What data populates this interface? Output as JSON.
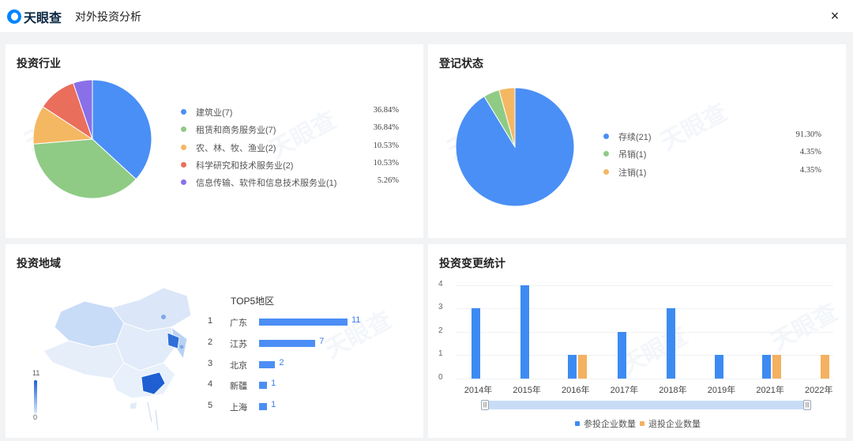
{
  "header": {
    "logo_text": "天眼查",
    "title": "对外投资分析",
    "close_label": "×"
  },
  "watermark": "天眼查",
  "industry": {
    "title": "投资行业",
    "chart_data": {
      "type": "pie",
      "slices": [
        {
          "label": "建筑业(7)",
          "value": 36.84,
          "pct": "36.84%",
          "color": "#4a8ff5"
        },
        {
          "label": "租赁和商务服务业(7)",
          "value": 36.84,
          "pct": "36.84%",
          "color": "#8fcb85"
        },
        {
          "label": "农、林、牧、渔业(2)",
          "value": 10.53,
          "pct": "10.53%",
          "color": "#f4b862"
        },
        {
          "label": "科学研究和技术服务业(2)",
          "value": 10.53,
          "pct": "10.53%",
          "color": "#ea6e5c"
        },
        {
          "label": "信息传输、软件和信息技术服务业(1)",
          "value": 5.26,
          "pct": "5.26%",
          "color": "#8970e8"
        }
      ]
    }
  },
  "status": {
    "title": "登记状态",
    "chart_data": {
      "type": "pie",
      "slices": [
        {
          "label": "存续(21)",
          "value": 91.3,
          "pct": "91.30%",
          "color": "#4a8ff5"
        },
        {
          "label": "吊销(1)",
          "value": 4.35,
          "pct": "4.35%",
          "color": "#8fcb85"
        },
        {
          "label": "注销(1)",
          "value": 4.35,
          "pct": "4.35%",
          "color": "#f4b862"
        }
      ]
    }
  },
  "region": {
    "title": "投资地域",
    "top5_title": "TOP5地区",
    "scale_max": "11",
    "scale_min": "0",
    "chart_data": {
      "type": "bar",
      "categories": [
        "广东",
        "江苏",
        "北京",
        "新疆",
        "上海"
      ],
      "ranks": [
        "1",
        "2",
        "3",
        "4",
        "5"
      ],
      "values": [
        11,
        7,
        2,
        1,
        1
      ]
    }
  },
  "changes": {
    "title": "投资变更统计",
    "legend": {
      "invest": "参投企业数量",
      "withdraw": "退投企业数量"
    },
    "colors": {
      "invest": "#3d8bf2",
      "withdraw": "#f4b160"
    },
    "chart_data": {
      "type": "bar",
      "categories": [
        "2014年",
        "2015年",
        "2016年",
        "2017年",
        "2018年",
        "2019年",
        "2021年",
        "2022年"
      ],
      "series": [
        {
          "name": "参投企业数量",
          "values": [
            3,
            4,
            1,
            2,
            3,
            1,
            1,
            0
          ]
        },
        {
          "name": "退投企业数量",
          "values": [
            0,
            0,
            1,
            0,
            0,
            0,
            1,
            1
          ]
        }
      ],
      "yticks": [
        "0",
        "1",
        "2",
        "3",
        "4"
      ],
      "ylim": [
        0,
        4
      ]
    }
  }
}
